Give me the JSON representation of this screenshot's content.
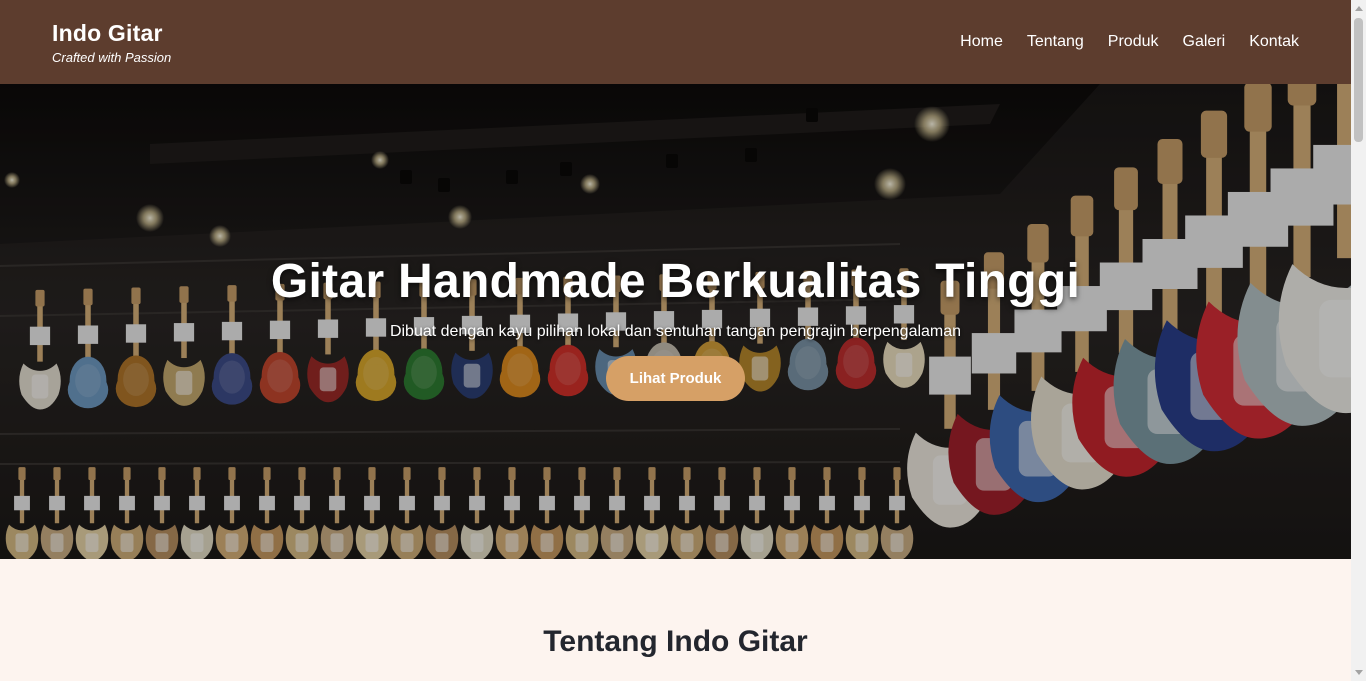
{
  "brand": {
    "name": "Indo Gitar",
    "tagline": "Crafted with Passion"
  },
  "nav": {
    "items": [
      {
        "label": "Home"
      },
      {
        "label": "Tentang"
      },
      {
        "label": "Produk"
      },
      {
        "label": "Galeri"
      },
      {
        "label": "Kontak"
      }
    ]
  },
  "hero": {
    "title": "Gitar Handmade Berkualitas Tinggi",
    "subtitle": "Dibuat dengan kayu pilihan lokal dan sentuhan tangan pengrajin berpengalaman",
    "cta_label": "Lihat Produk",
    "background_image": "guitar-store-wall-photo"
  },
  "about": {
    "title": "Tentang Indo Gitar"
  },
  "colors": {
    "header_bg": "#5d3d2e",
    "accent": "#d6a066",
    "section_bg": "#fdf4ef",
    "heading": "#23262e"
  }
}
